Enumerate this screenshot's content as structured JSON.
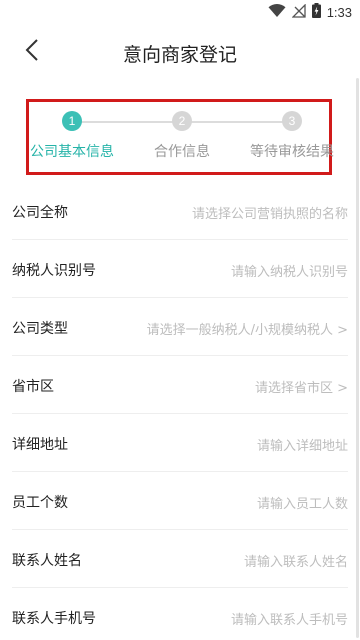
{
  "status_bar": {
    "time": "1:33",
    "icons": [
      "wifi-icon",
      "no-signal-icon",
      "battery-charging-icon"
    ]
  },
  "header": {
    "title": "意向商家登记",
    "back_icon": "chevron-left-icon"
  },
  "steps": [
    {
      "number": "1",
      "label": "公司基本信息",
      "state": "active"
    },
    {
      "number": "2",
      "label": "合作信息",
      "state": "inactive"
    },
    {
      "number": "3",
      "label": "等待审核结果",
      "state": "inactive"
    }
  ],
  "colors": {
    "accent": "#25b3a8",
    "highlight_border": "#d11a1a",
    "placeholder": "#bdbdbd"
  },
  "form": {
    "rows": [
      {
        "label": "公司全称",
        "placeholder": "请选择公司营销执照的名称"
      },
      {
        "label": "纳税人识别号",
        "placeholder": "请输入纳税人识别号"
      },
      {
        "label": "公司类型",
        "placeholder": "请选择一般纳税人/小规模纳税人 >"
      },
      {
        "label": "省市区",
        "placeholder": "请选择省市区 >"
      },
      {
        "label": "详细地址",
        "placeholder": "请输入详细地址"
      },
      {
        "label": "员工个数",
        "placeholder": "请输入员工人数"
      },
      {
        "label": "联系人姓名",
        "placeholder": "请输入联系人姓名"
      },
      {
        "label": "联系人手机号",
        "placeholder": "请输入联系人手机号"
      }
    ]
  }
}
